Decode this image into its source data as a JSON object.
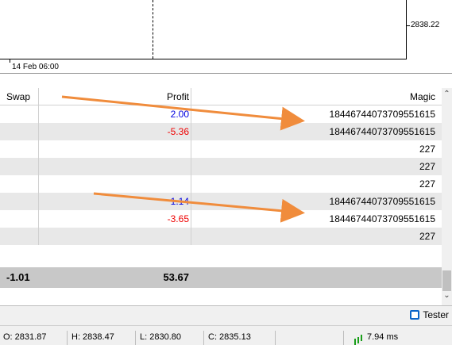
{
  "chart": {
    "price_label": "2838.22",
    "time_label": "14 Feb 06:00"
  },
  "table": {
    "headers": {
      "swap": "Swap",
      "profit": "Profit",
      "magic": "Magic"
    },
    "rows": [
      {
        "profit": "2.00",
        "magic": "18446744073709551615"
      },
      {
        "profit": "-5.36",
        "magic": "18446744073709551615"
      },
      {
        "profit": "",
        "magic": "227"
      },
      {
        "profit": "",
        "magic": "227"
      },
      {
        "profit": "",
        "magic": "227"
      },
      {
        "profit": "1.14",
        "magic": "18446744073709551615"
      },
      {
        "profit": "-3.65",
        "magic": "18446744073709551615"
      },
      {
        "profit": "",
        "magic": "227"
      }
    ],
    "total": {
      "swap": "-1.01",
      "profit": "53.67"
    }
  },
  "tester_tab": {
    "label": "Tester"
  },
  "status_bar": {
    "open": "O: 2831.87",
    "high": "H: 2838.47",
    "low": "L: 2830.80",
    "close": "C: 2835.13",
    "ping": "7.94 ms"
  },
  "colors": {
    "positive": "#0000e0",
    "negative": "#ee0000",
    "arrow": "#f08c3c"
  }
}
